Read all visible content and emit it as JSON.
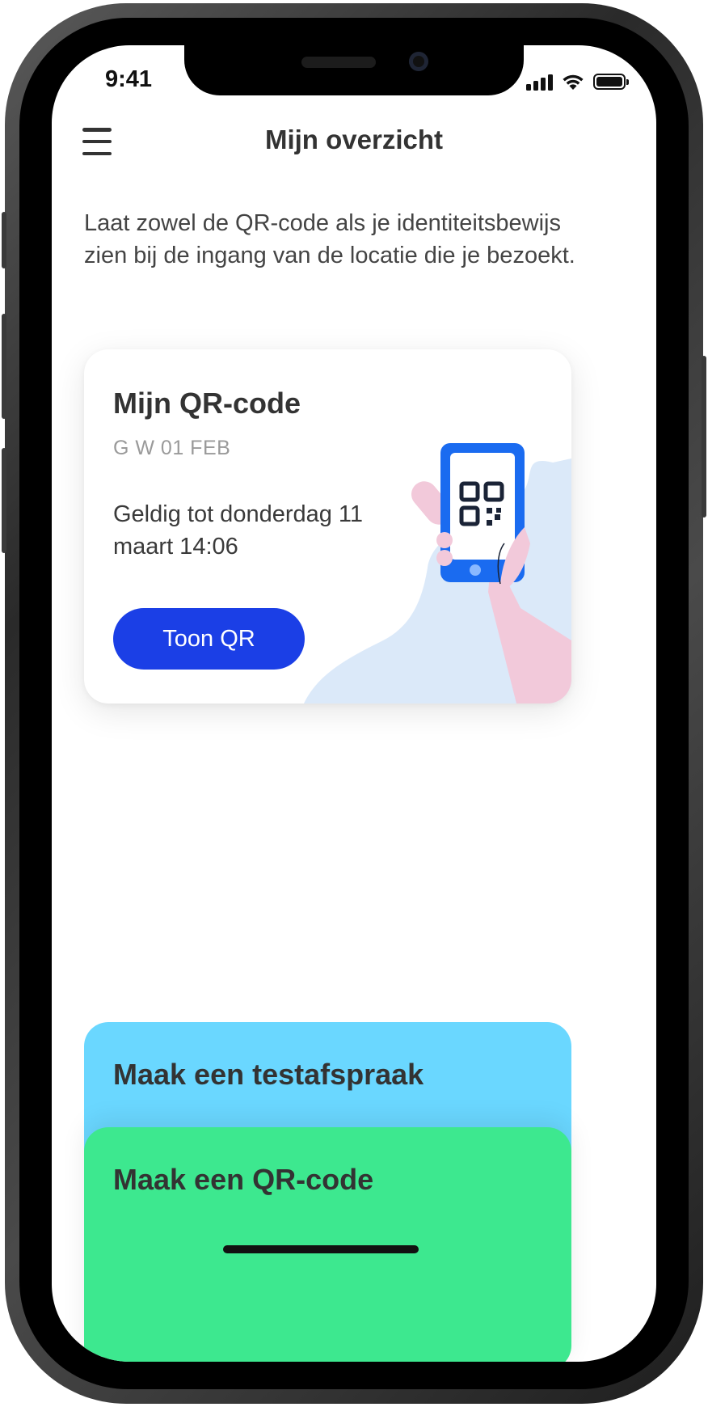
{
  "status_bar": {
    "time": "9:41"
  },
  "header": {
    "title": "Mijn overzicht"
  },
  "intro": "Laat zowel de QR-code als je identiteitsbewijs zien bij de ingang van de locatie die je bezoekt.",
  "qr_card": {
    "title": "Mijn QR-code",
    "subtitle": "G W 01 FEB",
    "validity": "Geldig tot donderdag 11 maart 14:06",
    "button_label": "Toon QR"
  },
  "actions": [
    {
      "label": "Maak een testafspraak",
      "color": "#6ad7ff"
    },
    {
      "label": "Maak een QR-code",
      "color": "#3de88f"
    }
  ],
  "icons": [
    "menu-icon",
    "signal-icon",
    "wifi-icon",
    "battery-icon",
    "phone-qr-illustration"
  ],
  "colors": {
    "primary_button": "#1b3fe6",
    "text": "#333333"
  }
}
